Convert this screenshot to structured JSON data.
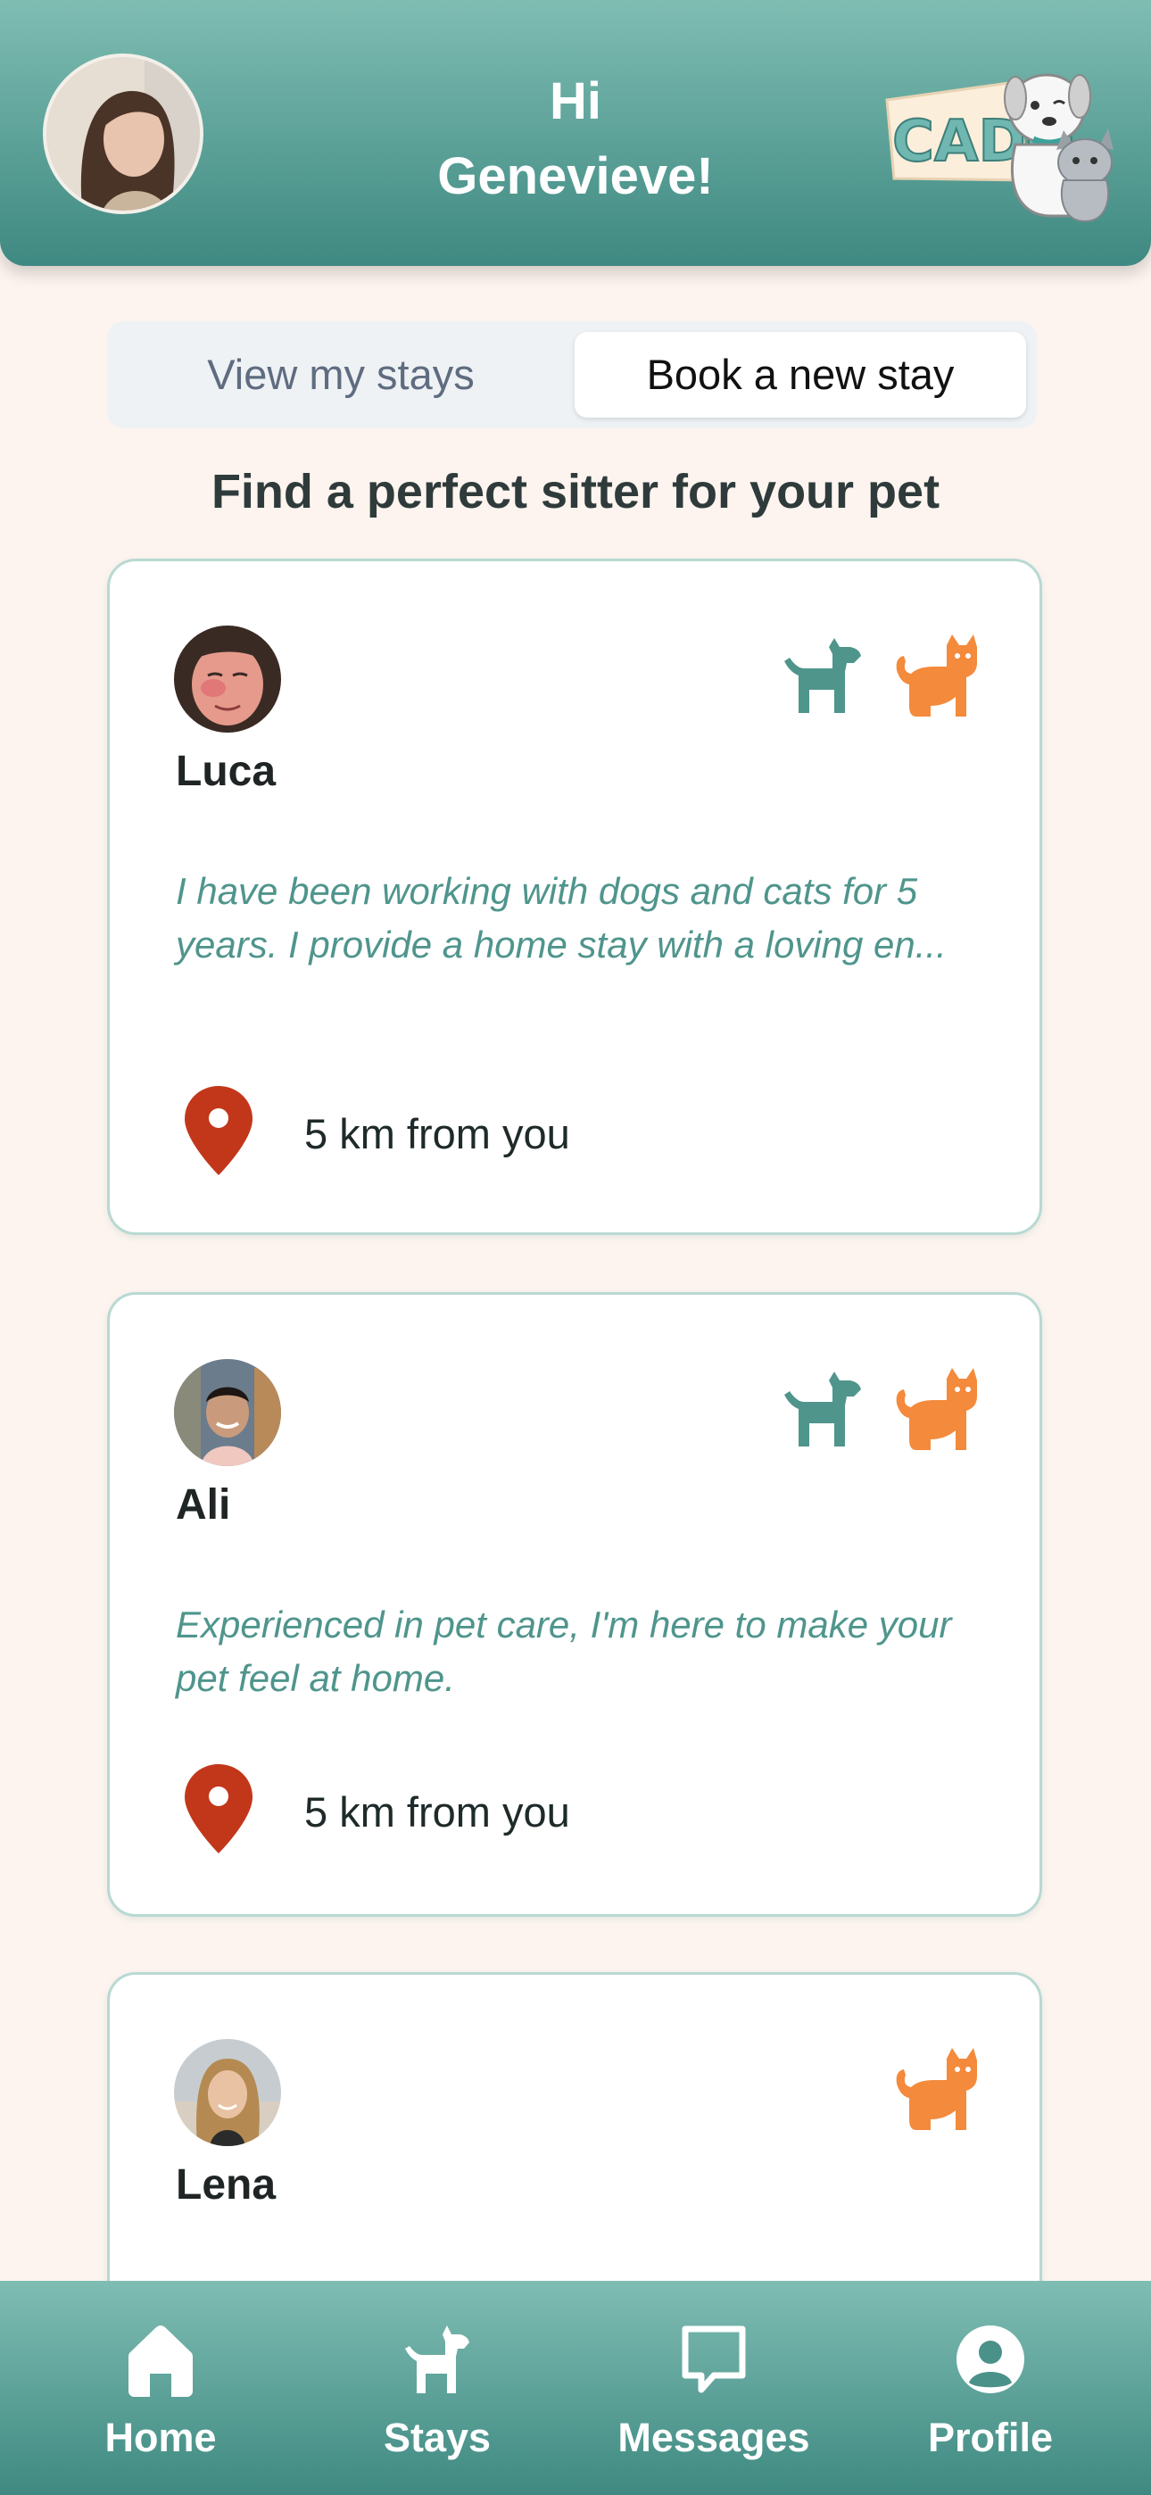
{
  "header": {
    "greeting": "Hi\nGenevieve!",
    "logo_text": "CADO",
    "user_avatar_icon": "user-avatar-photo"
  },
  "tabs": {
    "view_stays": "View my stays",
    "book_stay": "Book a new stay",
    "selected": "Book a new stay"
  },
  "section_title": "Find a perfect sitter for your pet",
  "colors": {
    "header_teal": "#3e8981",
    "dog_icon": "#4f958c",
    "cat_icon": "#f48a3c",
    "location_pin": "#c2371a",
    "background": "#fdf4ef"
  },
  "sitters": [
    {
      "name": "Luca",
      "pets": [
        "dog",
        "cat"
      ],
      "bio": "I have been working with dogs and cats for 5 years. I provide a home stay with a loving en...",
      "distance": "5 km from you"
    },
    {
      "name": "Ali",
      "pets": [
        "dog",
        "cat"
      ],
      "bio": "Experienced in pet care, I'm here to make your pet feel at home.",
      "distance": "5 km from you"
    },
    {
      "name": "Lena",
      "pets": [
        "cat"
      ],
      "bio": "",
      "distance": ""
    }
  ],
  "nav": [
    {
      "label": "Home",
      "icon": "home-icon"
    },
    {
      "label": "Stays",
      "icon": "dog-icon"
    },
    {
      "label": "Messages",
      "icon": "chat-icon"
    },
    {
      "label": "Profile",
      "icon": "profile-icon"
    }
  ]
}
